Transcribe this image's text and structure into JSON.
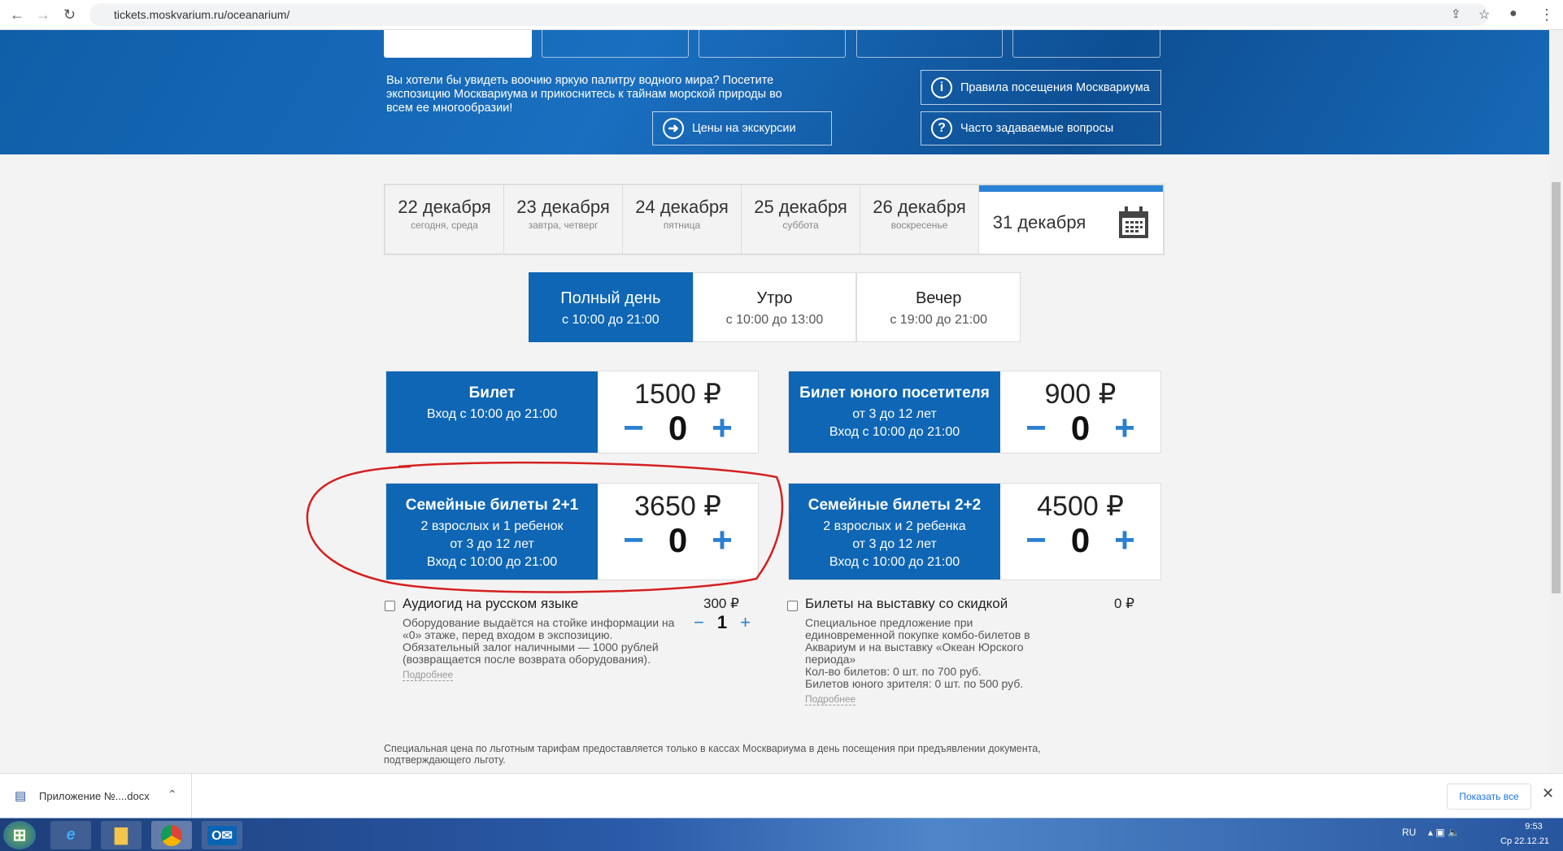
{
  "browser": {
    "url": "tickets.moskvarium.ru/oceanarium/"
  },
  "hero": {
    "text": "Вы хотели бы увидеть воочию яркую палитру водного мира? Посетите экспозицию Москвариума и прикоснитесь к тайнам морской природы во всем ее многообразии!",
    "btn_prices": "Цены на экскурсии",
    "btn_rules": "Правила посещения Москвариума",
    "btn_faq": "Часто задаваемые вопросы"
  },
  "dates": [
    {
      "d": "22 декабря",
      "s": "сегодня, среда"
    },
    {
      "d": "23 декабря",
      "s": "завтра, четверг"
    },
    {
      "d": "24 декабря",
      "s": "пятница"
    },
    {
      "d": "25 декабря",
      "s": "суббота"
    },
    {
      "d": "26 декабря",
      "s": "воскресенье"
    },
    {
      "d": "31 декабря",
      "s": ""
    }
  ],
  "times": [
    {
      "t": "Полный день",
      "r": "с 10:00 до 21:00"
    },
    {
      "t": "Утро",
      "r": "с 10:00 до 13:00"
    },
    {
      "t": "Вечер",
      "r": "с 19:00 до 21:00"
    }
  ],
  "tickets": [
    {
      "name": "Билет",
      "l1": "Вход с 10:00 до 21:00",
      "l2": "",
      "l3": "",
      "price": "1500 ₽",
      "qty": "0"
    },
    {
      "name": "Билет юного посетителя",
      "l1": "от 3 до 12 лет",
      "l2": "Вход с 10:00 до 21:00",
      "l3": "",
      "price": "900 ₽",
      "qty": "0"
    },
    {
      "name": "Семейные билеты 2+1",
      "l1": "2 взрослых и 1 ребенок",
      "l2": "от 3 до 12 лет",
      "l3": "Вход с 10:00 до 21:00",
      "price": "3650 ₽",
      "qty": "0"
    },
    {
      "name": "Семейные билеты 2+2",
      "l1": "2 взрослых и 2 ребенка",
      "l2": "от 3 до 12 лет",
      "l3": "Вход с 10:00 до 21:00",
      "price": "4500 ₽",
      "qty": "0"
    }
  ],
  "addons": {
    "audio": {
      "title": "Аудиогид на русском языке",
      "price": "300 ₽",
      "qty": "1",
      "desc": "Оборудование выдаётся на стойке информации на «0» этаже, перед входом в экспозицию. Обязательный залог наличными — 1000 рублей (возвращается после возврата оборудования).",
      "more": "Подробнее"
    },
    "exhibit": {
      "title": "Билеты на выставку со скидкой",
      "price": "0 ₽",
      "desc": "Специальное предложение при единовременной покупке комбо-билетов в Аквариум и на выставку «Океан Юрского периода»",
      "line1": "Кол-во билетов: 0 шт. по 700 руб.",
      "line2": "Билетов юного зрителя: 0 шт. по 500 руб.",
      "more": "Подробнее"
    }
  },
  "footnote": "Специальная цена по льготным тарифам предоставляется только в кассах Москвариума в день посещения при предъявлении документа, подтверждающего льготу.",
  "download": {
    "file": "Приложение №....docx",
    "show_all": "Показать все"
  },
  "taskbar": {
    "lang": "RU",
    "time": "9:53",
    "date": "Ср 22.12.21"
  },
  "colors": {
    "brand": "#0e66b5",
    "accent": "#2a82d4",
    "annotation": "#d42020"
  }
}
